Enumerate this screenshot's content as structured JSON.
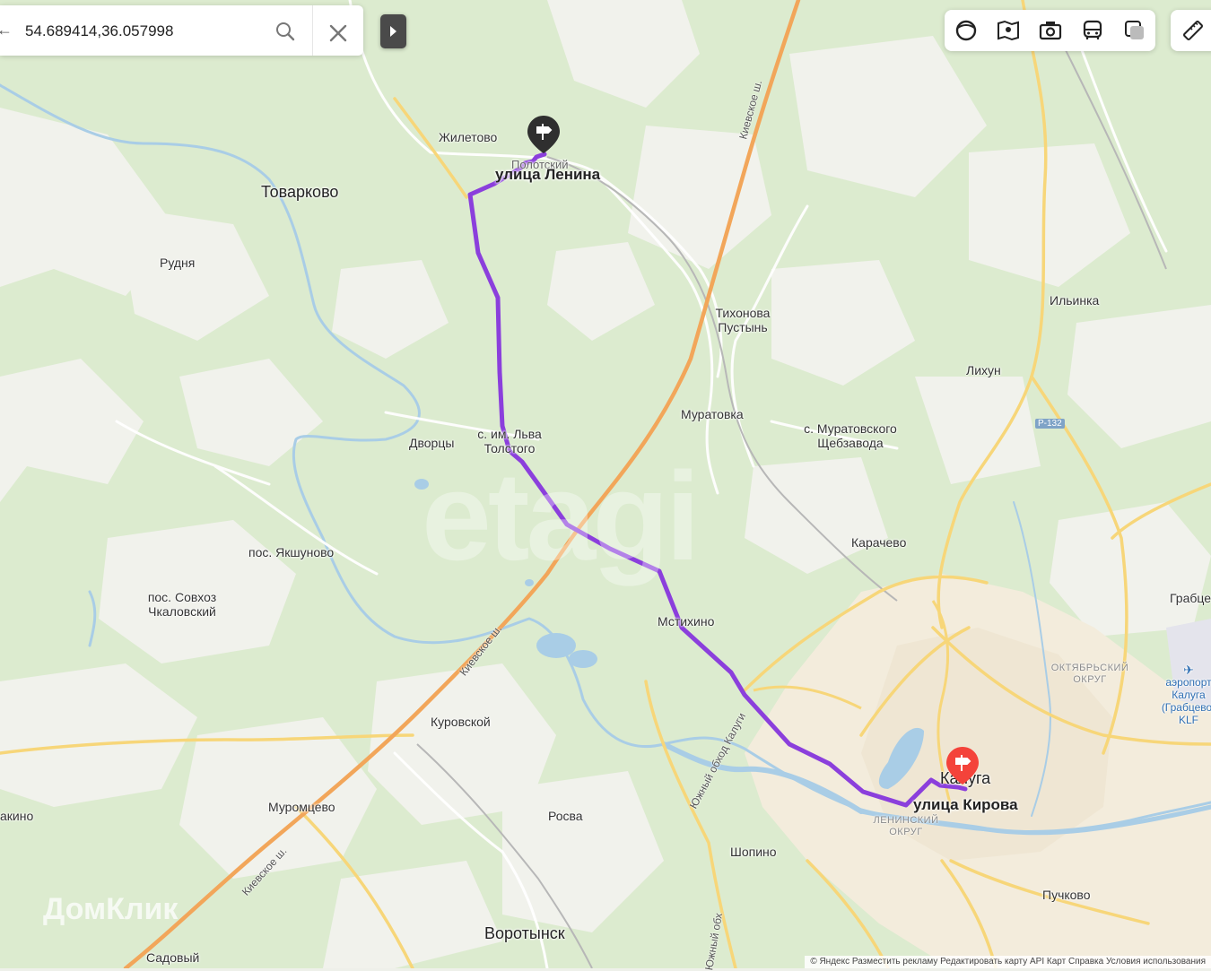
{
  "search": {
    "value": "54.689414,36.057998"
  },
  "toolbar": {
    "icons": [
      "layers-icon",
      "panorama-icon",
      "camera-icon",
      "bus-icon",
      "layers-square-icon"
    ],
    "ruler_icon": "ruler-icon"
  },
  "route": {
    "start_label": "улица Ленина",
    "end_label": "улица Кирова",
    "color": "#8b3fdc",
    "start_pin_color": "#2f2f2f",
    "end_pin_color": "#f4433a"
  },
  "places": {
    "zhiletovo": "Жилетово",
    "polotnyany": "Полотский",
    "tovarkovo": "Товарково",
    "rudnya": "Рудня",
    "tikhonova": "Тихонова",
    "pustyn": "Пустынь",
    "ilinka": "Ильинка",
    "likhun": "Лихун",
    "muratovka": "Муратовка",
    "muratovsk1": "с. Муратовского",
    "muratovsk2": "Щебзавода",
    "tolstogo1": "с. им. Льва",
    "tolstogo2": "Толстого",
    "dvortsy": "Дворцы",
    "yakshunovo": "пос. Якшуново",
    "karachevo": "Карачево",
    "chkalov1": "пос. Совхоз",
    "chkalov2": "Чкаловский",
    "grabtsevo": "Грабце",
    "mstikhino": "Мстихино",
    "kurovskoy": "Куровской",
    "muromtsevo": "Муромцево",
    "rosva": "Росва",
    "shopino": "Шопино",
    "kaluga": "Калуга",
    "puchkovo": "Пучково",
    "vorotynsk": "Воротынск",
    "sadovy": "Садовый",
    "akino": "акино"
  },
  "districts": {
    "oktyabrsky1": "ОКТЯБРЬСКИЙ",
    "oktyabrsky2": "ОКРУГ",
    "leninsky1": "ЛЕНИНСКИЙ",
    "leninsky2": "ОКРУГ"
  },
  "airport": {
    "line1": "аэропорт",
    "line2": "Калуга",
    "line3": "(Грабцево)",
    "line4": "KLF"
  },
  "roads": {
    "kievskoe_north": "Киевское ш.",
    "kievskoe_mid": "Киевское ш.",
    "kievskoe_south": "Киевское ш.",
    "yuzhny_obkhod": "Южный обход Калуги",
    "yuzhny_obkhod2": "Южный обх",
    "r132": "Р-132"
  },
  "watermark": "etagi",
  "domklik": "ДомКлик",
  "footer": "© Яндекс   Разместить рекламу   Редактировать карту   API Карт   Справка   Условия использования"
}
